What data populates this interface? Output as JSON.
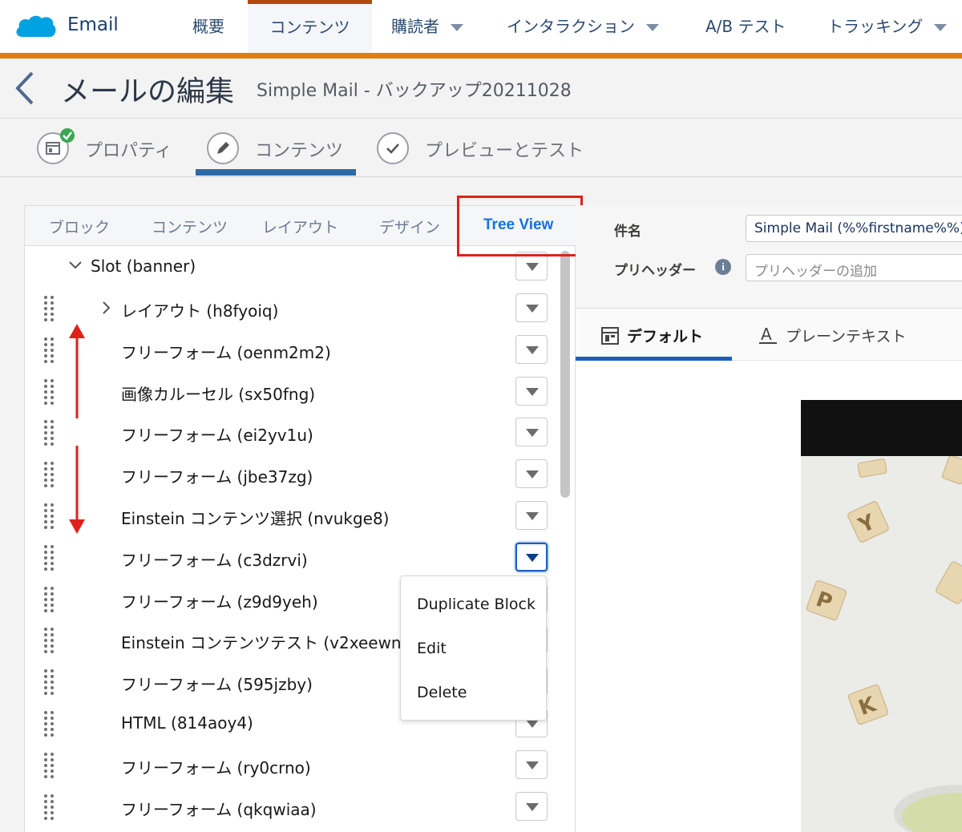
{
  "app": {
    "name": "Email"
  },
  "top_nav": {
    "tabs": [
      {
        "label": "概要"
      },
      {
        "label": "コンテンツ"
      },
      {
        "label": "購読者"
      },
      {
        "label": "インタラクション"
      },
      {
        "label": "A/B テスト"
      },
      {
        "label": "トラッキング"
      }
    ]
  },
  "header": {
    "title": "メールの編集",
    "subtitle": "Simple Mail - バックアップ20211028"
  },
  "steps": [
    {
      "label": "プロパティ"
    },
    {
      "label": "コンテンツ"
    },
    {
      "label": "プレビューとテスト"
    }
  ],
  "left_tabs": [
    {
      "label": "ブロック"
    },
    {
      "label": "コンテンツ"
    },
    {
      "label": "レイアウト"
    },
    {
      "label": "デザイン"
    },
    {
      "label": "Tree View"
    }
  ],
  "tree": {
    "slot": "Slot (banner)",
    "items": [
      {
        "label": "レイアウト (h8fyoiq)"
      },
      {
        "label": "フリーフォーム (oenm2m2)"
      },
      {
        "label": "画像カルーセル (sx50fng)"
      },
      {
        "label": "フリーフォーム (ei2yv1u)"
      },
      {
        "label": "フリーフォーム (jbe37zg)"
      },
      {
        "label": "Einstein コンテンツ選択 (nvukge8)"
      },
      {
        "label": "フリーフォーム (c3dzrvi)"
      },
      {
        "label": "フリーフォーム (z9d9yeh)"
      },
      {
        "label": "Einstein コンテンツテスト (v2xeewn"
      },
      {
        "label": "フリーフォーム (595jzby)"
      },
      {
        "label": "HTML (814aoy4)"
      },
      {
        "label": "フリーフォーム (ry0crno)"
      },
      {
        "label": "フリーフォーム (qkqwiaa)"
      }
    ]
  },
  "menu": {
    "items": [
      {
        "label": "Duplicate Block"
      },
      {
        "label": "Edit"
      },
      {
        "label": "Delete"
      }
    ]
  },
  "right": {
    "subject_label": "件名",
    "subject_value": "Simple Mail (%%firstname%%)",
    "preheader_label": "プリヘッダー",
    "preheader_placeholder": "プリヘッダーの追加",
    "view_tabs": [
      {
        "label": "デフォルト"
      },
      {
        "label": "プレーンテキスト"
      }
    ]
  },
  "colors": {
    "accent_orange": "#e07f10",
    "active_blue": "#1273de",
    "highlight_red": "#e0211b"
  }
}
